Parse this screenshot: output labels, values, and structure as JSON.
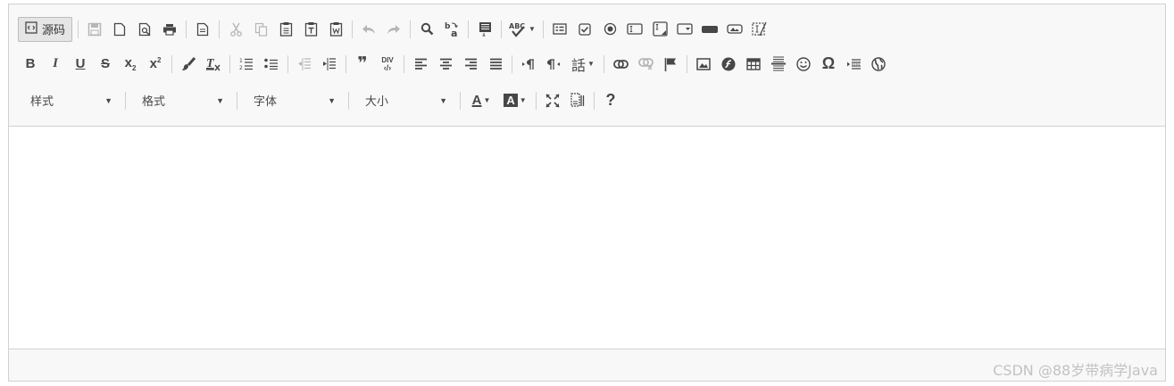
{
  "toolbar": {
    "source_label": "源码",
    "styles_combo": "样式",
    "format_combo": "格式",
    "font_combo": "字体",
    "size_combo": "大小",
    "bold": "B",
    "italic": "I",
    "underline": "U",
    "strike": "S",
    "subscript": "x",
    "superscript": "x",
    "blockquote": "❞",
    "div": "DIV",
    "language": "話",
    "special_char": "Ω",
    "help": "?",
    "spellcheck": "ABC",
    "text_color": "A",
    "bg_color": "A"
  },
  "footer": {
    "watermark": "CSDN @88岁带病学Java"
  },
  "colors": {
    "toolbar_bg": "#f8f8f8",
    "border": "#d1d1d1",
    "icon": "#474747",
    "icon_disabled": "#b6b6b6"
  }
}
